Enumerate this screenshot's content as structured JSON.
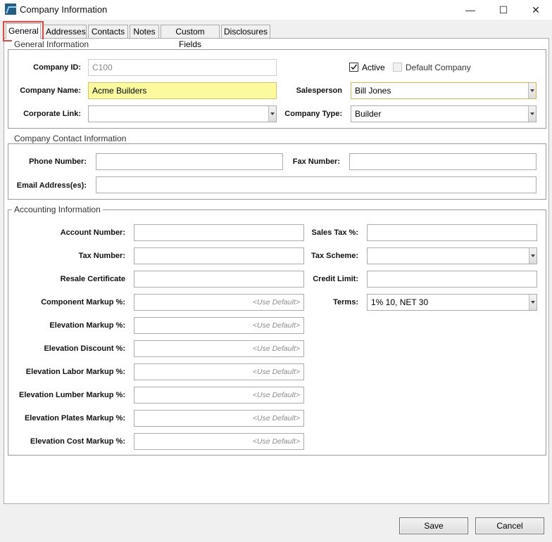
{
  "window": {
    "title": "Company Information",
    "minimize": "—",
    "maximize": "☐",
    "close": "✕"
  },
  "tabs": [
    "General",
    "Addresses",
    "Contacts",
    "Notes",
    "Custom Fields",
    "Disclosures"
  ],
  "general_info": {
    "legend": "General Information",
    "company_id_label": "Company ID:",
    "company_id_value": "C100",
    "active_label": "Active",
    "active_checked": true,
    "default_company_label": "Default Company",
    "default_company_checked": false,
    "company_name_label": "Company Name:",
    "company_name_value": "Acme Builders",
    "salesperson_label": "Salesperson",
    "salesperson_value": "Bill Jones",
    "corporate_link_label": "Corporate Link:",
    "corporate_link_value": "",
    "company_type_label": "Company Type:",
    "company_type_value": "Builder"
  },
  "contact_info": {
    "legend": "Company Contact Information",
    "phone_label": "Phone Number:",
    "phone_value": "",
    "fax_label": "Fax Number:",
    "fax_value": "",
    "email_label": "Email Address(es):",
    "email_value": ""
  },
  "accounting": {
    "legend": "Accounting Information",
    "account_number_label": "Account Number:",
    "tax_number_label": "Tax Number:",
    "resale_certificate_label": "Resale Certificate",
    "component_markup_label": "Component Markup %:",
    "elevation_markup_label": "Elevation Markup %:",
    "elevation_discount_label": "Elevation Discount %:",
    "elevation_labor_markup_label": "Elevation Labor Markup %:",
    "elevation_lumber_markup_label": "Elevation Lumber Markup %:",
    "elevation_plates_markup_label": "Elevation Plates Markup %:",
    "elevation_cost_markup_label": "Elevation Cost Markup %:",
    "use_default": "<Use Default>",
    "sales_tax_label": "Sales Tax %:",
    "tax_scheme_label": "Tax Scheme:",
    "credit_limit_label": "Credit Limit:",
    "terms_label": "Terms:",
    "terms_value": "1% 10, NET 30"
  },
  "buttons": {
    "save": "Save",
    "cancel": "Cancel"
  },
  "colors": {
    "highlight_border": "#e8453c",
    "required_field": "#fbfb9e"
  }
}
